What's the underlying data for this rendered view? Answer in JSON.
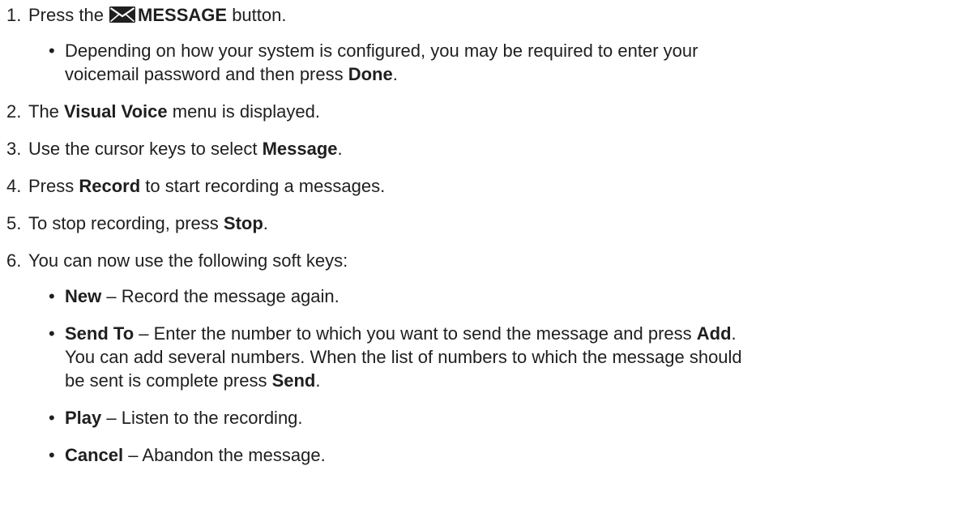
{
  "steps": [
    {
      "num": "1.",
      "pre": "Press the ",
      "icon": "envelope-icon",
      "bold": "MESSAGE",
      "post": " button.",
      "sub": {
        "bullet": "•",
        "line1": "Depending on how your system is configured, you may be required to enter your",
        "line2_pre": "voicemail password and then press ",
        "line2_bold": "Done",
        "line2_post": "."
      }
    },
    {
      "num": "2.",
      "pre": "The ",
      "bold": "Visual Voice",
      "post": " menu is displayed."
    },
    {
      "num": "3.",
      "pre": "Use the cursor keys to select ",
      "bold": "Message",
      "post": "."
    },
    {
      "num": "4.",
      "pre": "Press ",
      "bold": "Record",
      "post": " to start recording a messages."
    },
    {
      "num": "5.",
      "pre": "To stop recording, press ",
      "bold": "Stop",
      "post": "."
    },
    {
      "num": "6.",
      "text": "You can now use the following soft keys:",
      "softkeys": [
        {
          "bullet": "•",
          "key": "New",
          "desc": " – Record the message again."
        },
        {
          "bullet": "•",
          "key": "Send To",
          "desc_line1": " – Enter the number to which you want to send the message and press ",
          "desc_bold1": "Add",
          "desc_after1": ".",
          "desc_line2": "You can add several numbers. When the list of numbers to which the message should",
          "desc_line3_pre": "be sent is complete press ",
          "desc_bold2": "Send",
          "desc_line3_post": "."
        },
        {
          "bullet": "•",
          "key": "Play",
          "desc": " – Listen to the recording."
        },
        {
          "bullet": "•",
          "key": "Cancel",
          "desc": " – Abandon the message."
        }
      ]
    }
  ]
}
